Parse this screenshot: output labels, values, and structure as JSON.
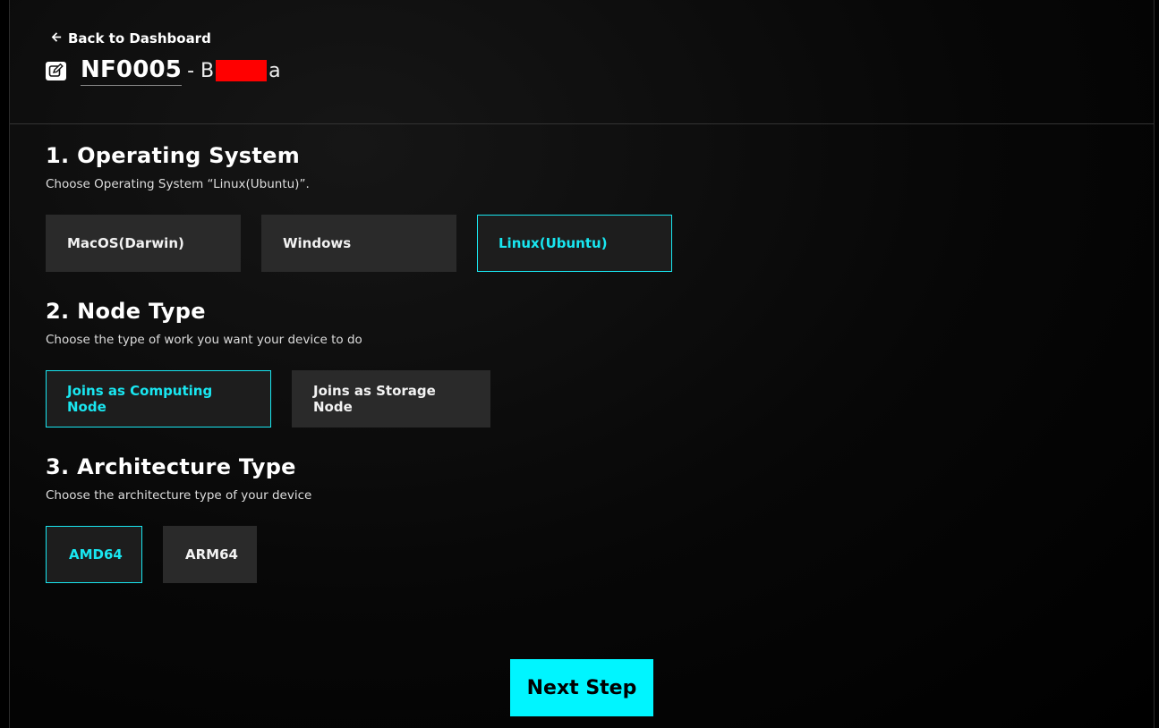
{
  "header": {
    "back_label": "Back to Dashboard",
    "node_id": "NF0005",
    "node_name_prefix": "- B",
    "node_name_suffix": "a"
  },
  "sections": [
    {
      "title": "1. Operating System",
      "subtitle": "Choose Operating System “Linux(Ubuntu)”.",
      "options": [
        "MacOS(Darwin)",
        "Windows",
        "Linux(Ubuntu)"
      ],
      "selected": "Linux(Ubuntu)"
    },
    {
      "title": "2. Node Type",
      "subtitle": "Choose the type of work you want your device to do",
      "options": [
        "Joins as Computing Node",
        "Joins as Storage Node"
      ],
      "selected": "Joins as Computing Node"
    },
    {
      "title": "3. Architecture Type",
      "subtitle": "Choose the architecture type of your device",
      "options": [
        "AMD64",
        "ARM64"
      ],
      "selected": "AMD64"
    }
  ],
  "next_label": "Next Step",
  "colors": {
    "accent": "#00f5ff",
    "option_bg": "#2a2a2a",
    "redaction": "#ff0000"
  }
}
